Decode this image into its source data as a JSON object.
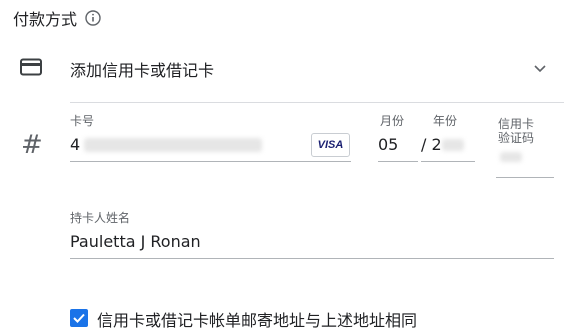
{
  "section": {
    "title": "付款方式"
  },
  "method": {
    "label": "添加信用卡或借记卡"
  },
  "card": {
    "number_label": "卡号",
    "number_value": "4",
    "brand": "VISA",
    "month_label": "月份",
    "month_value": "05",
    "year_label": "年份",
    "year_value": "/ 2",
    "cvc_label_line1": "信用卡",
    "cvc_label_line2": "验证码"
  },
  "holder": {
    "label": "持卡人姓名",
    "value": "Pauletta J Ronan"
  },
  "billing": {
    "same_address_label": "信用卡或借记卡帐单邮寄地址与上述地址相同"
  },
  "colors": {
    "accent": "#1a73e8",
    "text": "#202124",
    "secondary": "#5f6368",
    "divider": "#dadce0"
  }
}
